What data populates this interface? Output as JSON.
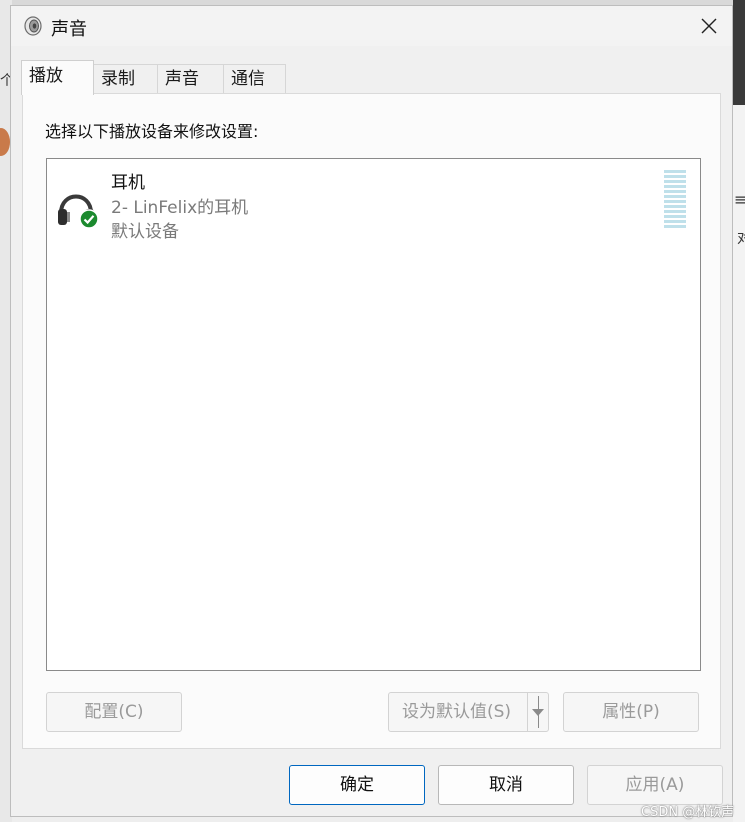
{
  "window": {
    "title": "声音"
  },
  "tabs": [
    {
      "label": "播放",
      "active": true
    },
    {
      "label": "录制",
      "active": false
    },
    {
      "label": "声音",
      "active": false
    },
    {
      "label": "通信",
      "active": false
    }
  ],
  "playback": {
    "instruction": "选择以下播放设备来修改设置:",
    "devices": [
      {
        "name": "耳机",
        "description": "2- LinFelix的耳机",
        "status": "默认设备",
        "icon": "headphones-icon",
        "status_icon": "check-circle-icon"
      }
    ],
    "buttons": {
      "configure": "配置(C)",
      "set_default": "设为默认值(S)",
      "properties": "属性(P)"
    }
  },
  "footer": {
    "ok": "确定",
    "cancel": "取消",
    "apply": "应用(A)"
  },
  "watermark": "CSDN @林钦声",
  "colors": {
    "accent": "#0067c0",
    "check_green": "#1b8a2e",
    "level_meter": "#bfe0ea"
  }
}
